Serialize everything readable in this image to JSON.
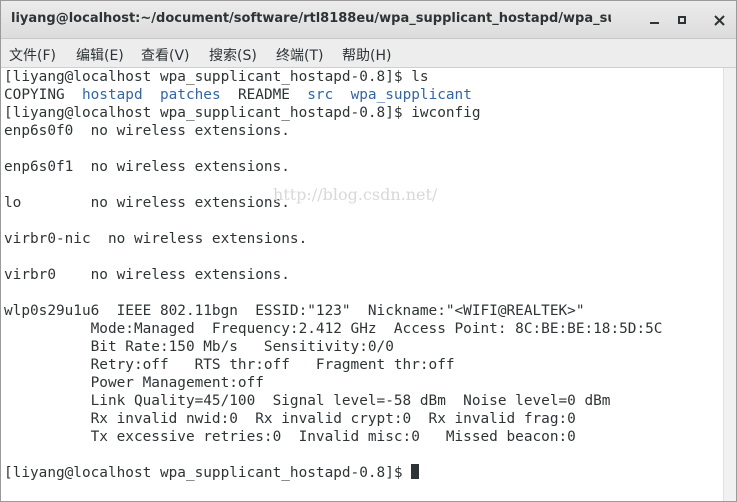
{
  "window": {
    "title": "liyang@localhost:~/document/software/rtl8188eu/wpa_supplicant_hostapd/wpa_suppli⋯"
  },
  "menu": {
    "items": [
      "文件(F)",
      "编辑(E)",
      "查看(V)",
      "搜索(S)",
      "终端(T)",
      "帮助(H)"
    ]
  },
  "watermark": "http://blog.csdn.net/",
  "terminal": {
    "lines": [
      [
        {
          "t": "[liyang@localhost wpa_supplicant_hostapd-0.8]$ ls"
        }
      ],
      [
        {
          "t": "COPYING  "
        },
        {
          "t": "hostapd",
          "c": "blue"
        },
        {
          "t": "  "
        },
        {
          "t": "patches",
          "c": "blue"
        },
        {
          "t": "  README  "
        },
        {
          "t": "src",
          "c": "blue"
        },
        {
          "t": "  "
        },
        {
          "t": "wpa_supplicant",
          "c": "blue"
        }
      ],
      [
        {
          "t": "[liyang@localhost wpa_supplicant_hostapd-0.8]$ iwconfig"
        }
      ],
      [
        {
          "t": "enp6s0f0  no wireless extensions."
        }
      ],
      [
        {
          "t": ""
        }
      ],
      [
        {
          "t": "enp6s0f1  no wireless extensions."
        }
      ],
      [
        {
          "t": ""
        }
      ],
      [
        {
          "t": "lo        no wireless extensions."
        }
      ],
      [
        {
          "t": ""
        }
      ],
      [
        {
          "t": "virbr0-nic  no wireless extensions."
        }
      ],
      [
        {
          "t": ""
        }
      ],
      [
        {
          "t": "virbr0    no wireless extensions."
        }
      ],
      [
        {
          "t": ""
        }
      ],
      [
        {
          "t": "wlp0s29u1u6  IEEE 802.11bgn  ESSID:\"123\"  Nickname:\"<WIFI@REALTEK>\""
        }
      ],
      [
        {
          "t": "          Mode:Managed  Frequency:2.412 GHz  Access Point: 8C:BE:BE:18:5D:5C"
        }
      ],
      [
        {
          "t": "          Bit Rate:150 Mb/s   Sensitivity:0/0"
        }
      ],
      [
        {
          "t": "          Retry:off   RTS thr:off   Fragment thr:off"
        }
      ],
      [
        {
          "t": "          Power Management:off"
        }
      ],
      [
        {
          "t": "          Link Quality=45/100  Signal level=-58 dBm  Noise level=0 dBm"
        }
      ],
      [
        {
          "t": "          Rx invalid nwid:0  Rx invalid crypt:0  Rx invalid frag:0"
        }
      ],
      [
        {
          "t": "          Tx excessive retries:0  Invalid misc:0   Missed beacon:0"
        }
      ],
      [
        {
          "t": ""
        }
      ],
      [
        {
          "t": "[liyang@localhost wpa_supplicant_hostapd-0.8]$ "
        },
        {
          "cursor": true
        }
      ]
    ]
  }
}
